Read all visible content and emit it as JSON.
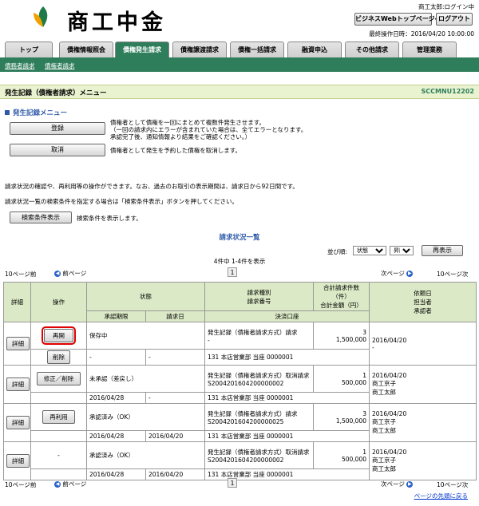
{
  "header": {
    "logo_text": "商工中金",
    "user_label": "商工太郎:ログイン中",
    "webtop_button": "ビジネスWebトップページへ",
    "logout_button": "ログアウト",
    "last_op": "最終操作日時：2016/04/20 10:00:00"
  },
  "tabs": [
    "トップ",
    "債権情報照会",
    "債権発生請求",
    "債権譲渡請求",
    "債権一括請求",
    "融資申込",
    "その他請求",
    "管理業務"
  ],
  "active_tab_index": 2,
  "sub_nav": [
    "債務者請求",
    "債権者請求"
  ],
  "page_title": "発生記録（債権者請求）メニュー",
  "screen_id": "SCCMNU12202",
  "menu": {
    "section_title": "発生記録メニュー",
    "register_button": "登録",
    "register_desc_1": "債権者として債権を一回にまとめて複数件発生させます。",
    "register_desc_2": "（一回の請求内にエラーが含まれていた場合は、全てエラーとなります。",
    "register_desc_3": "承認完了後、通知情報より結果をご確認ください。）",
    "cancel_button": "取消",
    "cancel_desc": "債権者として発生を予約した債権を取消します。"
  },
  "info": {
    "line1": "請求状況の確認や、再利用等の操作ができます。なお、過去のお取引の表示期間は、請求日から92日間です。",
    "line2": "請求状況一覧の検索条件を指定する場合は「検索条件表示」ボタンを押してください。",
    "search_button": "検索条件表示",
    "search_desc": "検索条件を表示します。"
  },
  "list": {
    "title": "請求状況一覧",
    "sort_label": "並び順:",
    "sort_key": "状態",
    "sort_order": "昇順",
    "redisplay_button": "再表示",
    "count_text": "4件中 1-4件を表示",
    "prev10": "10ページ前",
    "prev": "前ページ",
    "page": "1",
    "next": "次ページ",
    "next10": "10ページ次",
    "back_to_top": "ページの先頭に戻る"
  },
  "columns": {
    "detail": "詳細",
    "operation": "操作",
    "status": "状態",
    "approval_deadline": "承認期限",
    "request_date": "請求日",
    "req_type_1": "請求種別",
    "req_type_2": "請求番号",
    "total_1": "合計請求件数（件）",
    "total_2": "合計金額（円）",
    "settle": "決済口座",
    "right_1": "依頼日",
    "right_2": "担当者",
    "right_3": "承認者"
  },
  "rows": [
    {
      "detail": "詳細",
      "op1": "再開",
      "op2": "削除",
      "status": "保存中",
      "deadline": "-",
      "req_date": "-",
      "type": "発生記録（債権者請求方式）請求",
      "number": "-",
      "count": "3",
      "amount": "1,500,000",
      "account": "131 本店営業部 当座 0000001",
      "date": "2016/04/20",
      "person": "-",
      "approver": ""
    },
    {
      "detail": "詳細",
      "op1": "修正／削除",
      "op2": "",
      "status": "未承認（差戻し）",
      "deadline": "2016/04/28",
      "req_date": "-",
      "type": "発生記録（債権者請求方式）取消請求",
      "number": "S2004201604200000002",
      "count": "1",
      "amount": "500,000",
      "account": "131 本店営業部 当座 0000001",
      "date": "2016/04/20",
      "person": "商工京子",
      "approver": "商工太郎"
    },
    {
      "detail": "詳細",
      "op1": "再利用",
      "op2": "",
      "status": "承認済み（OK）",
      "deadline": "2016/04/28",
      "req_date": "2016/04/20",
      "type": "発生記録（債権者請求方式）請求",
      "number": "S2004201604200000025",
      "count": "3",
      "amount": "1,500,000",
      "account": "131 本店営業部 当座 0000001",
      "date": "2016/04/20",
      "person": "商工京子",
      "approver": "商工太郎"
    },
    {
      "detail": "詳細",
      "op1": "-",
      "op2": "",
      "status": "承認済み（OK）",
      "deadline": "2016/04/28",
      "req_date": "2016/04/20",
      "type": "発生記録（債権者請求方式）取消請求",
      "number": "S2004201604200000002",
      "count": "1",
      "amount": "500,000",
      "account": "131 本店営業部 当座 0000001",
      "date": "2016/04/20",
      "person": "商工京子",
      "approver": "商工太郎"
    }
  ],
  "colors": {
    "brand_green": "#2e7d5b",
    "header_bg": "#dbe9c6",
    "highlight": "#e00000"
  }
}
